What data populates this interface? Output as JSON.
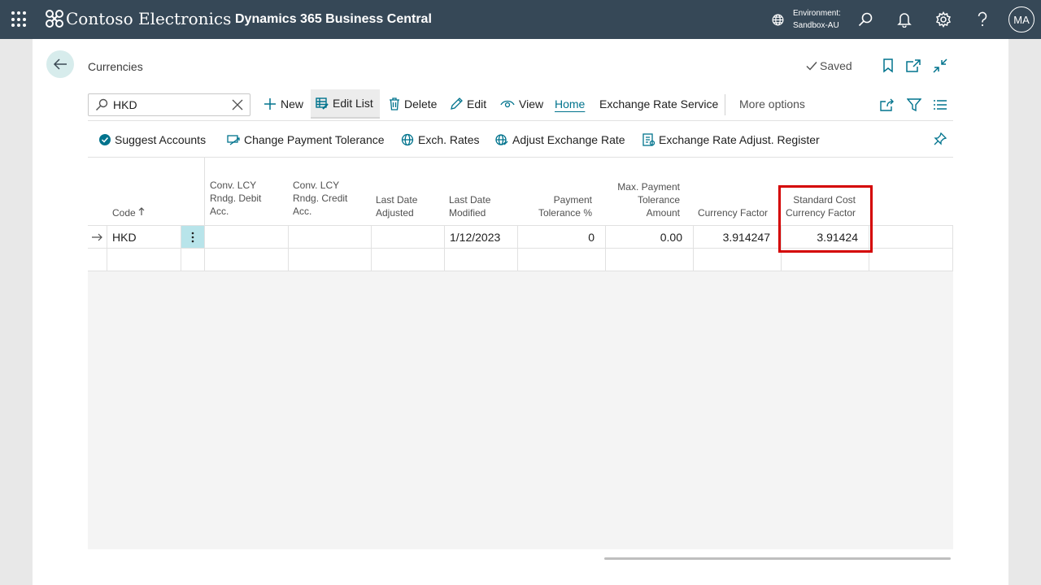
{
  "topbar": {
    "brand": "Contoso Electronics",
    "product": "Dynamics 365 Business Central",
    "environment_label": "Environment:",
    "environment_value": "Sandbox-AU",
    "user_initials": "MA"
  },
  "page": {
    "title": "Currencies",
    "saved_label": "Saved"
  },
  "actions": {
    "search_value": "HKD",
    "new_label": "New",
    "edit_list_label": "Edit List",
    "delete_label": "Delete",
    "edit_label": "Edit",
    "view_label": "View",
    "home_label": "Home",
    "exchange_rate_service_label": "Exchange Rate Service",
    "more_options_label": "More options"
  },
  "sub_actions": {
    "suggest_accounts": "Suggest Accounts",
    "change_payment_tolerance": "Change Payment Tolerance",
    "exch_rates": "Exch. Rates",
    "adjust_exchange_rate": "Adjust Exchange Rate",
    "exchange_rate_adjust_register": "Exchange Rate Adjust. Register"
  },
  "grid": {
    "columns": {
      "code": "Code",
      "conv_debit_1": "Conv. LCY",
      "conv_debit_2": "Rndg. Debit",
      "conv_debit_3": "Acc.",
      "conv_credit_1": "Conv. LCY",
      "conv_credit_2": "Rndg. Credit",
      "conv_credit_3": "Acc.",
      "last_adjusted_1": "Last Date",
      "last_adjusted_2": "Adjusted",
      "last_modified_1": "Last Date",
      "last_modified_2": "Modified",
      "payment_tol_1": "Payment",
      "payment_tol_2": "Tolerance %",
      "max_payment_1": "Max. Payment",
      "max_payment_2": "Tolerance",
      "max_payment_3": "Amount",
      "currency_factor": "Currency Factor",
      "std_cost_1": "Standard Cost",
      "std_cost_2": "Currency Factor"
    },
    "rows": [
      {
        "code": "HKD",
        "conv_debit": "",
        "conv_credit": "",
        "last_date_adjusted": "",
        "last_date_modified": "1/12/2023",
        "payment_tolerance_pct": "0",
        "max_payment_tolerance_amount": "0.00",
        "currency_factor": "3.914247",
        "standard_cost_currency_factor": "3.91424"
      }
    ]
  },
  "colors": {
    "topbar": "#364857",
    "accent": "#00738d",
    "highlight": "#d40000"
  }
}
